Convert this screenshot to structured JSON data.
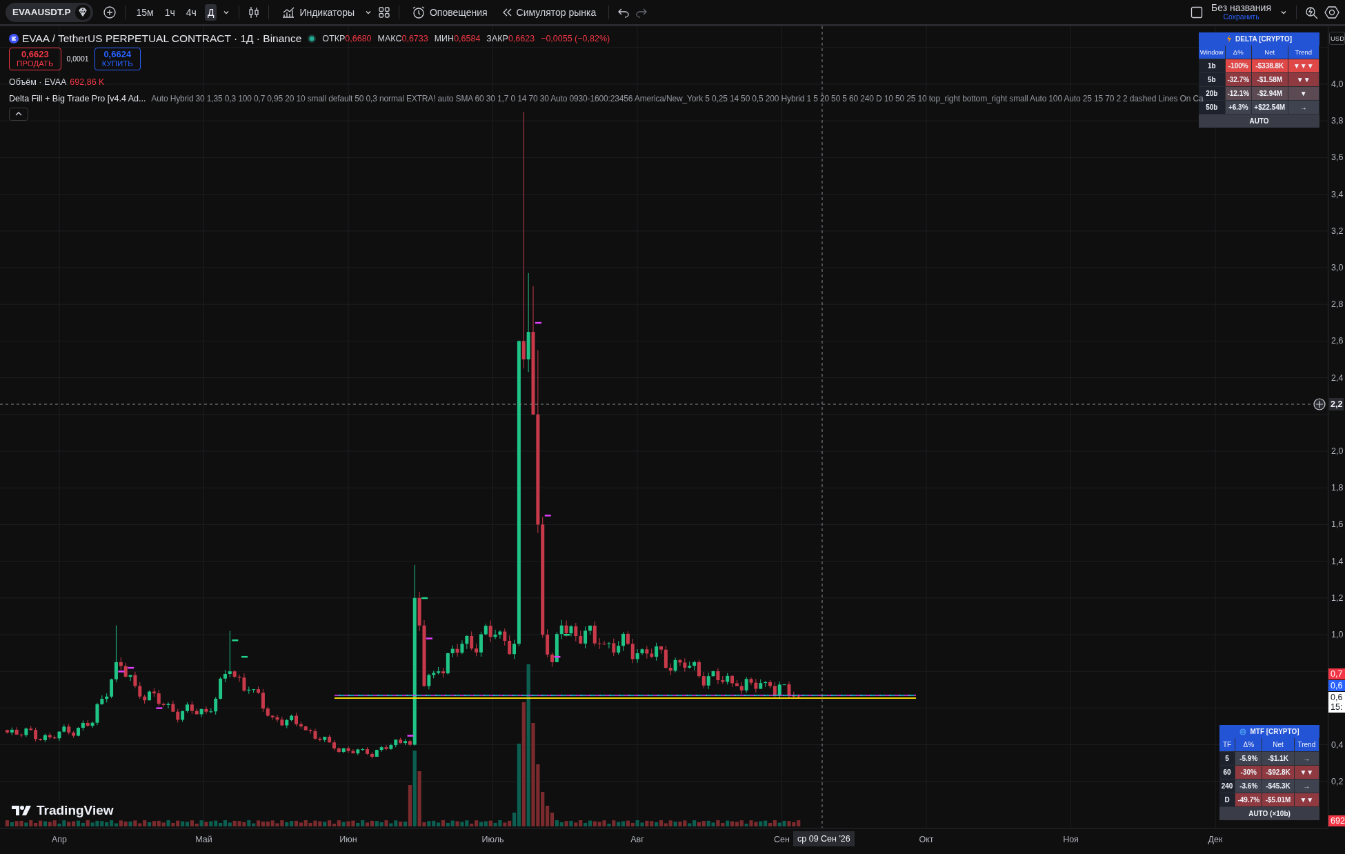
{
  "toolbar": {
    "symbol": "EVAAUSDT.P",
    "intervals": [
      {
        "label": "15м",
        "selected": false
      },
      {
        "label": "1ч",
        "selected": false
      },
      {
        "label": "4ч",
        "selected": false
      },
      {
        "label": "Д",
        "selected": true
      }
    ],
    "indicators": "Индикаторы",
    "alerts": "Оповещения",
    "replay": "Симулятор рынка",
    "layout_name": "Без названия",
    "layout_save": "Сохранить"
  },
  "legend": {
    "title": "EVAA / TetherUS PERPETUAL CONTRACT · 1Д · Binance",
    "ohlc": [
      {
        "label": "ОТКР",
        "value": "0,6680"
      },
      {
        "label": "МАКС",
        "value": "0,6733"
      },
      {
        "label": "МИН",
        "value": "0,6584"
      },
      {
        "label": "ЗАКР",
        "value": "0,6623"
      }
    ],
    "change": "−0,0055 (−0,82%)",
    "sell": {
      "price": "0,6623",
      "label": "ПРОДАТЬ"
    },
    "spread": "0,0001",
    "buy": {
      "price": "0,6624",
      "label": "КУПИТЬ"
    },
    "volume": {
      "label": "Объём · EVAA",
      "value": "692,86 K"
    },
    "indicator": {
      "name": "Delta Fill + Big Trade Pro [v4.4 Ad...",
      "params": "Auto Hybrid 30 1,35 0,3 100 0,7 0,95 20 10 small default 50 0,3 normal EXTRA! auto SMA 60 30 1,7 0 14 70 30 Auto 0930-1600:23456 America/New_York 5 0,25 14 50 0,5 200 Hybrid 1 5 20 50 5 60 240 D 10 50 25 10 top_right bottom_right small Auto 100 Auto 25 15 70 2 2 dashed Lines On Ca"
    }
  },
  "delta_table": {
    "title": "DELTA [CRYPTO]",
    "columns": [
      "Window",
      "Δ%",
      "Net",
      "Trend"
    ],
    "rows": [
      {
        "cells": [
          "1b",
          "-100%",
          "-$338.8K",
          "▼▼▼"
        ],
        "color": "#e04848"
      },
      {
        "cells": [
          "5b",
          "-32.7%",
          "-$1.58M",
          "▼▼"
        ],
        "color": "#8e3a40"
      },
      {
        "cells": [
          "20b",
          "-12.1%",
          "-$2.94M",
          "▼"
        ],
        "color": "#5c4a52"
      },
      {
        "cells": [
          "50b",
          "+6.3%",
          "+$22.54M",
          "→"
        ],
        "color": "#3f4350"
      }
    ],
    "footer": "AUTO"
  },
  "mtf_table": {
    "title": "MTF [CRYPTO]",
    "columns": [
      "TF",
      "Δ%",
      "Net",
      "Trend"
    ],
    "rows": [
      {
        "cells": [
          "5",
          "-5.9%",
          "-$1.1K",
          "→"
        ],
        "color": "#3f4350"
      },
      {
        "cells": [
          "60",
          "-30%",
          "-$92.8K",
          "▼▼"
        ],
        "color": "#8e3a40"
      },
      {
        "cells": [
          "240",
          "-3.6%",
          "-$45.3K",
          "→"
        ],
        "color": "#3f4350"
      },
      {
        "cells": [
          "D",
          "-49.7%",
          "-$5.01M",
          "▼▼"
        ],
        "color": "#8e3a40"
      }
    ],
    "footer": "AUTO (×10b)"
  },
  "branding": "TradingView",
  "price_axis": {
    "currency": "USD",
    "ticks": [
      "4,0",
      "3,8",
      "3,6",
      "3,4",
      "3,2",
      "3,0",
      "2,8",
      "2,6",
      "2,4",
      "2,0",
      "1,8",
      "1,6",
      "1,4",
      "1,2",
      "1,0",
      "0,4",
      "0,2"
    ],
    "crosshair_label": "2,2",
    "labels": [
      {
        "text": "0,7",
        "color": "#f23645"
      },
      {
        "text": "0,6",
        "color": "#2962ff"
      },
      {
        "text": "0,6",
        "subtext": "15:",
        "color": "#ffffff"
      },
      {
        "text": "692",
        "color": "#f23645"
      }
    ]
  },
  "time_axis": {
    "months": [
      "Апр",
      "Май",
      "Июн",
      "Июль",
      "Авг",
      "Сен",
      "Окт",
      "Ноя",
      "Дек"
    ],
    "crosshair_label": "ср 09 Сен '26"
  }
}
